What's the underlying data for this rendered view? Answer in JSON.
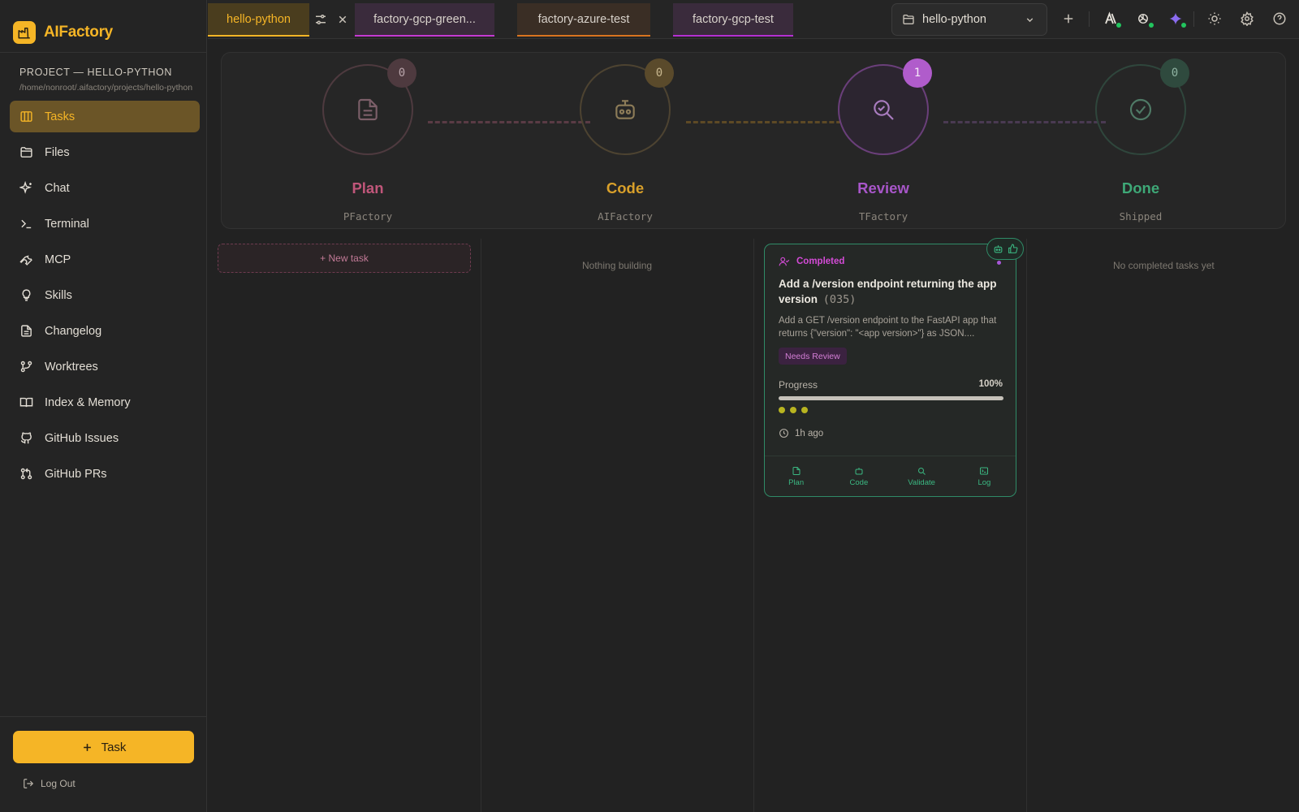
{
  "brand": {
    "name": "AIFactory"
  },
  "project": {
    "title": "PROJECT — HELLO-PYTHON",
    "path": "/home/nonroot/.aifactory/projects/hello-python"
  },
  "nav": [
    {
      "label": "Tasks",
      "icon": "columns-icon",
      "active": true
    },
    {
      "label": "Files",
      "icon": "folder-icon"
    },
    {
      "label": "Chat",
      "icon": "sparkles-icon"
    },
    {
      "label": "Terminal",
      "icon": "terminal-icon"
    },
    {
      "label": "MCP",
      "icon": "wrench-icon"
    },
    {
      "label": "Skills",
      "icon": "lightbulb-icon"
    },
    {
      "label": "Changelog",
      "icon": "document-icon"
    },
    {
      "label": "Worktrees",
      "icon": "git-branch-icon"
    },
    {
      "label": "Index & Memory",
      "icon": "book-icon"
    },
    {
      "label": "GitHub Issues",
      "icon": "github-icon"
    },
    {
      "label": "GitHub PRs",
      "icon": "git-pull-request-icon"
    }
  ],
  "task_button": {
    "label": "Task"
  },
  "logout": {
    "label": "Log Out"
  },
  "tabs": [
    {
      "label": "hello-python",
      "active": true,
      "color": "#f5b526"
    },
    {
      "label": "factory-gcp-green...",
      "color": "#c43ad1"
    },
    {
      "label": "factory-azure-test",
      "color": "#d9741f"
    },
    {
      "label": "factory-gcp-test",
      "color": "#b42fd1"
    }
  ],
  "project_selector": {
    "value": "hello-python"
  },
  "pipeline": [
    {
      "name": "Plan",
      "sub": "PFactory",
      "count": "0",
      "color": "#c0567a",
      "icon": "document-icon"
    },
    {
      "name": "Code",
      "sub": "AIFactory",
      "count": "0",
      "color": "#d9a02a",
      "icon": "robot-icon"
    },
    {
      "name": "Review",
      "sub": "TFactory",
      "count": "1",
      "color": "#a856c9",
      "icon": "search-check-icon"
    },
    {
      "name": "Done",
      "sub": "Shipped",
      "count": "0",
      "color": "#3ea877",
      "icon": "check-circle-icon"
    }
  ],
  "board": {
    "new_task": "+ New task",
    "code_empty": "Nothing building",
    "done_empty": "No completed tasks yet"
  },
  "card": {
    "status": "Completed",
    "title": "Add a /version endpoint returning the app version",
    "number": "(035)",
    "description": "Add a GET /version endpoint to the FastAPI app that returns {\"version\": \"<app version>\"} as JSON....",
    "badge": "Needs Review",
    "progress_label": "Progress",
    "progress_value": "100%",
    "progress_fraction": 1.0,
    "time": "1h ago",
    "actions": [
      {
        "label": "Plan",
        "icon": "document-icon"
      },
      {
        "label": "Code",
        "icon": "robot-icon"
      },
      {
        "label": "Validate",
        "icon": "search-icon"
      },
      {
        "label": "Log",
        "icon": "terminal-icon"
      }
    ]
  }
}
